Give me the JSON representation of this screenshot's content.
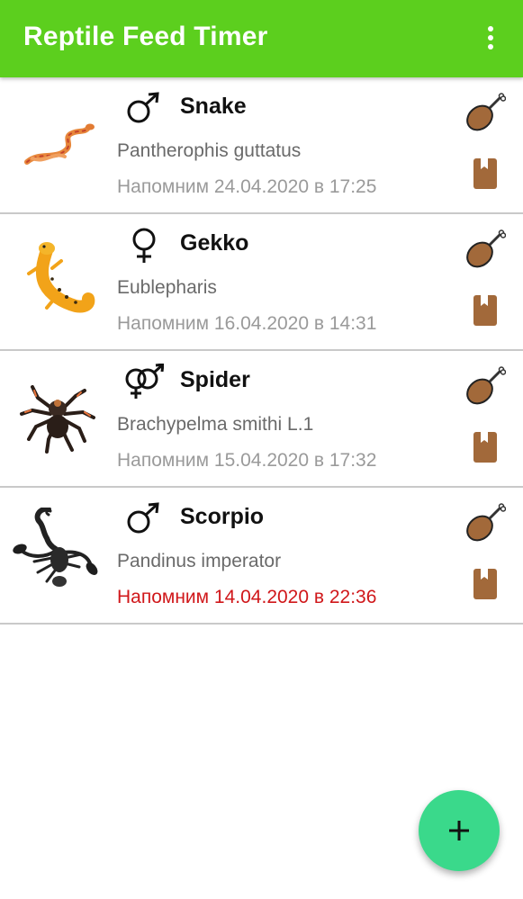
{
  "app_bar": {
    "title": "Reptile Feed Timer",
    "overflow_icon": "more-vert-icon",
    "color": "#5ccf1e"
  },
  "animals": [
    {
      "name": "Snake",
      "species": "Pantherophis guttatus",
      "reminder": "Напомним 24.04.2020 в 17:25",
      "gender": "male",
      "photo_icon": "corn-snake-photo",
      "overdue": false
    },
    {
      "name": "Gekko",
      "species": "Eublepharis",
      "reminder": "Напомним 16.04.2020 в 14:31",
      "gender": "female",
      "photo_icon": "leopard-gecko-photo",
      "overdue": false
    },
    {
      "name": "Spider",
      "species": "Brachypelma smithi L.1",
      "reminder": "Напомним 15.04.2020 в 17:32",
      "gender": "hermaphrodite",
      "photo_icon": "tarantula-photo",
      "overdue": false
    },
    {
      "name": "Scorpio",
      "species": "Pandinus imperator",
      "reminder": "Напомним 14.04.2020 в 22:36",
      "gender": "male",
      "photo_icon": "emperor-scorpion-photo",
      "overdue": true
    }
  ],
  "row_actions": {
    "feed_icon": "drumstick-icon",
    "journal_icon": "bookmark-book-icon"
  },
  "colors": {
    "reminder_normal": "#9a9a9a",
    "reminder_overdue": "#d0171a",
    "fab": "#3ad98b"
  },
  "fab": {
    "icon": "plus-icon"
  }
}
